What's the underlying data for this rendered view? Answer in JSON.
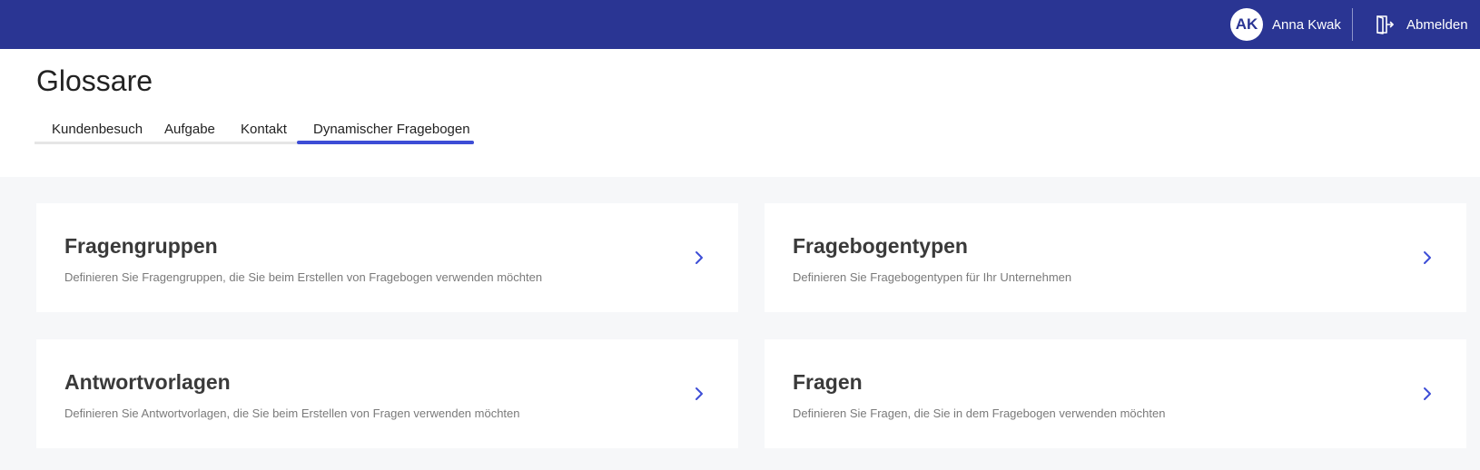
{
  "topbar": {
    "avatar_initials": "AK",
    "user_name": "Anna Kwak",
    "logout_label": "Abmelden",
    "background_color": "#2a3593"
  },
  "page": {
    "title": "Glossare"
  },
  "tabs": [
    {
      "label": "Kundenbesuch",
      "active": false
    },
    {
      "label": "Aufgabe",
      "active": false
    },
    {
      "label": "Kontakt",
      "active": false
    },
    {
      "label": "Dynamischer Fragebogen",
      "active": true
    }
  ],
  "cards": [
    {
      "title": "Fragengruppen",
      "description": "Definieren Sie Fragengruppen, die Sie beim Erstellen von Fragebogen verwenden möchten"
    },
    {
      "title": "Fragebogentypen",
      "description": "Definieren Sie Fragebogentypen für Ihr Unternehmen"
    },
    {
      "title": "Antwortvorlagen",
      "description": "Definieren Sie Antwortvorlagen, die Sie beim Erstellen von Fragen verwenden möchten"
    },
    {
      "title": "Fragen",
      "description": "Definieren Sie Fragen, die Sie in dem Fragebogen verwenden möchten"
    }
  ],
  "icons": {
    "logout": "logout-door-icon",
    "card_arrow": "chevron-right-icon"
  },
  "colors": {
    "accent": "#3d4dd6",
    "page_background": "#f6f7f9"
  }
}
